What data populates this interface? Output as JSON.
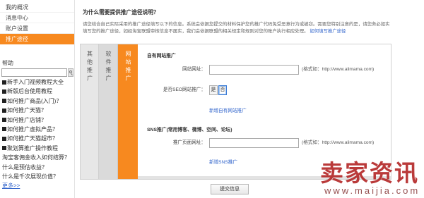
{
  "sidebar": {
    "nav": [
      {
        "label": "我的概况",
        "active": false
      },
      {
        "label": "消息中心",
        "active": false
      },
      {
        "label": "账户设置",
        "active": false
      },
      {
        "label": "推广途径",
        "active": true
      }
    ],
    "help": {
      "title": "帮助",
      "search": {
        "value": "",
        "button_icon": "search-icon"
      },
      "items": [
        {
          "label": "新手入门视频教程大全",
          "icon": "square-bullet-icon"
        },
        {
          "label": "新版后台使用教程",
          "icon": "square-bullet-icon"
        },
        {
          "label": "如何推广商品(入门)？",
          "icon": "square-bullet-icon"
        },
        {
          "label": "如何推广天猫？",
          "icon": "square-bullet-icon"
        },
        {
          "label": "如何推广店铺？",
          "icon": "square-bullet-icon"
        },
        {
          "label": "如何推广虚拟产品？",
          "icon": "square-bullet-icon"
        },
        {
          "label": "如何推广天猫超市？",
          "icon": "square-bullet-icon"
        },
        {
          "label": "聚划算推广操作教程",
          "icon": "square-bullet-icon"
        },
        {
          "label": "淘宝客佣金收入如何结算？",
          "icon": null
        },
        {
          "label": "什么是预估收益？",
          "icon": null
        },
        {
          "label": "什么是千次展现价值？",
          "icon": null
        }
      ],
      "more_label": "更多>>"
    }
  },
  "main": {
    "title": "为什么需要提供推广途径说明？",
    "intro": "请您结合自己实际采用的推广途径填写以下的信息。系统会依据您提交的材料保护您的推广代码免受恶意行为或被窃。需要您特别注意的是，请您务必如实填写您的推广途径，如经淘宝联盟审核信息不属实，我们会依据联盟的相关规定和规则对您的账户执行相应处理。",
    "intro_link": "如何填写推广途径",
    "tabs": [
      {
        "label": "其他推广",
        "active": false
      },
      {
        "label": "软件推广",
        "active": false
      },
      {
        "label": "网站推广",
        "active": true
      }
    ],
    "own_site": {
      "heading": "自有网站推广",
      "url_label": "网站网址：",
      "url_value": "",
      "url_hint": "(格式如：http://www.alimama.com)",
      "seo_label": "是否SEO网站推广：",
      "seo_options": [
        {
          "label": "是",
          "selected": false
        },
        {
          "label": "否",
          "selected": true
        }
      ],
      "add_link": "新增自有网站推广"
    },
    "sns": {
      "heading": "SNS推广(常用博客、微博、空间、论坛)",
      "url_label": "推广页面网址：",
      "url_value": "",
      "url_hint": "(格式如：http://www.alimama.com)",
      "add_link": "新增SNS推广"
    },
    "submit_label": "提交信息"
  },
  "watermark": {
    "text": "卖家资讯",
    "site": "www.maijia.com"
  },
  "colors": {
    "accent": "#f7891f",
    "link": "#3366cc",
    "selected_border": "#3a7bd5",
    "watermark": "#b52a2a"
  }
}
